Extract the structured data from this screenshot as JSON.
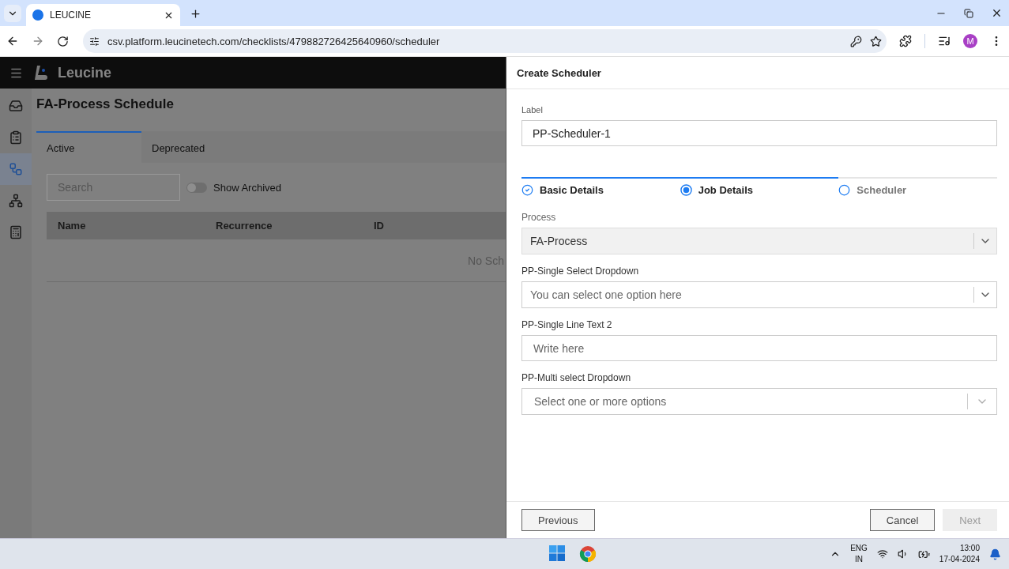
{
  "browser": {
    "tab_title": "LEUCINE",
    "url": "csv.platform.leucinetech.com/checklists/479882726425640960/scheduler",
    "profile_initial": "M"
  },
  "app": {
    "brand": "Leucine",
    "sidebar": [
      {
        "selected": false
      },
      {
        "selected": false
      },
      {
        "selected": true
      },
      {
        "selected": false
      },
      {
        "selected": false
      }
    ],
    "page_title": "FA-Process Schedule",
    "tabs": [
      {
        "label": "Active",
        "selected": true
      },
      {
        "label": "Deprecated",
        "selected": false
      }
    ],
    "search": {
      "placeholder": "Search"
    },
    "show_archived": {
      "label": "Show Archived",
      "on": false
    },
    "table": {
      "columns": [
        "Name",
        "Recurrence",
        "ID"
      ],
      "empty_message": "No Sch"
    }
  },
  "drawer": {
    "title": "Create Scheduler",
    "label_field": {
      "label": "Label",
      "value": "PP-Scheduler-1"
    },
    "steps": [
      {
        "label": "Basic Details",
        "kind": "done"
      },
      {
        "label": "Job Details",
        "kind": "current"
      },
      {
        "label": "Scheduler",
        "kind": "pending"
      }
    ],
    "fields": [
      {
        "kind": "select",
        "label": "Process",
        "value": "FA-Process",
        "disabled": true
      },
      {
        "kind": "select",
        "label": "PP-Single Select Dropdown",
        "placeholder": "You can select one option here",
        "disabled": false
      },
      {
        "kind": "text",
        "label": "PP-Single Line Text 2",
        "placeholder": "Write here",
        "disabled": false
      },
      {
        "kind": "multiselect",
        "label": "PP-Multi select Dropdown",
        "placeholder": "Select one or more options",
        "disabled": false
      }
    ],
    "buttons": [
      {
        "kind": "back",
        "label": "Previous",
        "disabled": false
      },
      {
        "kind": "cancel",
        "label": "Cancel",
        "disabled": false
      },
      {
        "kind": "next",
        "label": "Next",
        "disabled": true
      }
    ]
  },
  "taskbar": {
    "language": "ENG",
    "region": "IN",
    "time": "13:00",
    "date": "17-04-2024"
  }
}
